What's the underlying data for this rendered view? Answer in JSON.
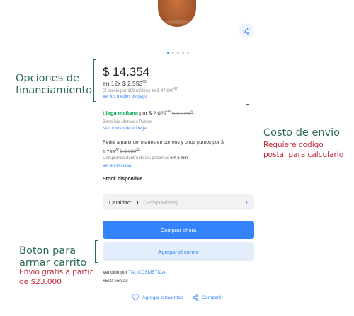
{
  "product": {
    "price": "$ 14.354",
    "installments_prefix": "en 12x $ 2.553",
    "installments_cents": "62",
    "price_note_prefix": "El precio por 100 mililtros es $ 47.846",
    "price_note_cents": "67",
    "payment_link": "Ver los medios de pago"
  },
  "shipping": {
    "arrival": "Llega mañana",
    "arrival_price_prefix": " por $ 2.029",
    "arrival_price_cents": "99",
    "arrival_old_price": "$ 2.929",
    "arrival_old_cents": "99",
    "benefit": "Beneficio Mercado Puntos",
    "more_link": "Más formas de entrega",
    "pickup_text": "Retirá a partir del martes en correos y otros puntos por $",
    "pickup_price": "1.739",
    "pickup_price_cents": "99",
    "pickup_old_price": "$ 2.639",
    "pickup_old_cents": "99",
    "pickup_deadline_prefix": "Comprando dentro de las próximas",
    "pickup_deadline_time": "6 h 6 min",
    "map_link": "Ver en el mapa"
  },
  "stock": "Stock disponible",
  "quantity": {
    "label": "Cantidad:",
    "value": "1",
    "available": "(3 disponibles)"
  },
  "buttons": {
    "buy_now": "Comprar ahora",
    "add_to_cart": "Agregar al carrito"
  },
  "seller": {
    "prefix": "Vendido por",
    "name": "TALICOSMETICA",
    "sales": "+500 ventas"
  },
  "footer": {
    "favorites": "Agregar a favoritos",
    "share": "Compartir"
  },
  "annotations": {
    "financing_line1": "Opciones de",
    "financing_line2": "financiamiento",
    "shipping_title": "Costo de envio",
    "shipping_sub_line1": "Requiere codigo",
    "shipping_sub_line2": "postal para calcularlo",
    "cart_line1": "Boton para",
    "cart_line2": "armar carrito",
    "cart_sub_line1": "Envio gratis a partir",
    "cart_sub_line2": "de $23.000"
  },
  "colors": {
    "accent": "#3483fa",
    "green": "#00a650",
    "annotation": "#2e6b4f",
    "annotation_sub": "#c2283a"
  }
}
